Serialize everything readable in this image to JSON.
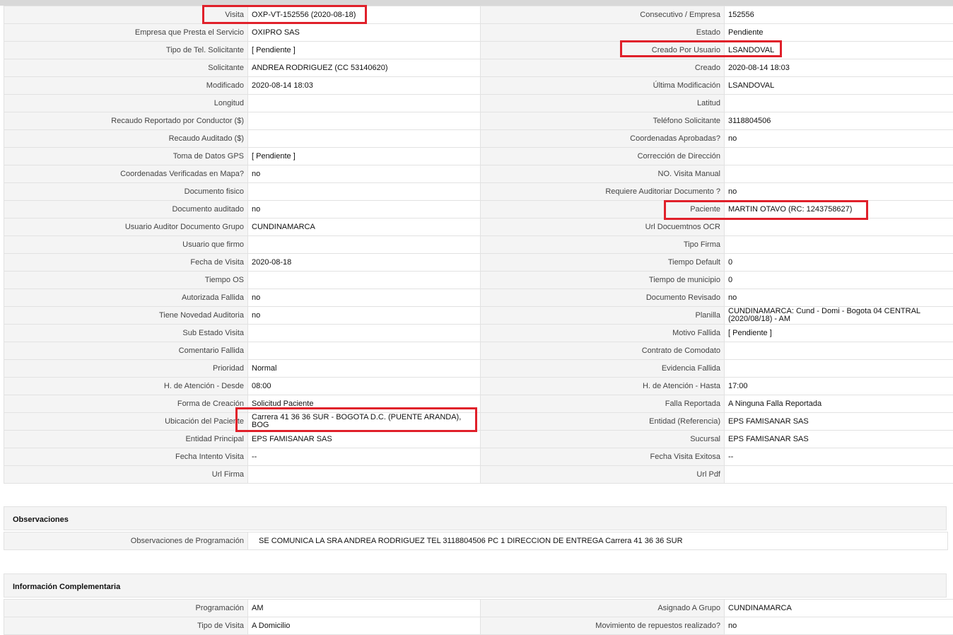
{
  "detalle": {
    "rows": [
      [
        "Visita",
        "OXP-VT-152556 (2020-08-18)",
        "Consecutivo / Empresa",
        "152556"
      ],
      [
        "Empresa que Presta el Servicio",
        "OXIPRO SAS",
        "Estado",
        "Pendiente"
      ],
      [
        "Tipo de Tel. Solicitante",
        "[ Pendiente ]",
        "Creado Por Usuario",
        "LSANDOVAL"
      ],
      [
        "Solicitante",
        "ANDREA RODRIGUEZ (CC 53140620)",
        "Creado",
        "2020-08-14 18:03"
      ],
      [
        "Modificado",
        "2020-08-14 18:03",
        "Última Modificación",
        " LSANDOVAL"
      ],
      [
        "Longitud",
        "",
        "Latitud",
        ""
      ],
      [
        "Recaudo Reportado por Conductor ($)",
        "",
        "Teléfono Solicitante",
        "3118804506"
      ],
      [
        "Recaudo Auditado ($)",
        "",
        "Coordenadas Aprobadas?",
        " no"
      ],
      [
        "Toma de Datos GPS",
        "[ Pendiente ]",
        "Corrección de Dirección",
        ""
      ],
      [
        "Coordenadas Verificadas en Mapa?",
        " no",
        "NO. Visita Manual",
        ""
      ],
      [
        "Documento fisico",
        "",
        "Requiere Auditoriar Documento ?",
        " no"
      ],
      [
        "Documento auditado",
        " no",
        "Paciente",
        "MARTIN OTAVO (RC: 1243758627)"
      ],
      [
        "Usuario Auditor Documento Grupo",
        "CUNDINAMARCA",
        "Url Docuemtnos OCR",
        ""
      ],
      [
        "Usuario que firmo",
        "",
        "Tipo Firma",
        ""
      ],
      [
        "Fecha de Visita",
        " 2020-08-18",
        "Tiempo Default",
        "0"
      ],
      [
        "Tiempo OS",
        "",
        "Tiempo de municipio",
        "0"
      ],
      [
        "Autorizada Fallida",
        " no",
        "Documento Revisado",
        " no"
      ],
      [
        "Tiene Novedad Auditoria",
        " no",
        "Planilla",
        "CUNDINAMARCA: Cund - Domi - Bogota 04 CENTRAL (2020/08/18) - AM"
      ],
      [
        "Sub Estado Visita",
        "",
        "Motivo Fallida",
        "[ Pendiente ]"
      ],
      [
        "Comentario Fallida",
        "",
        "Contrato de Comodato",
        ""
      ],
      [
        "Prioridad",
        "Normal",
        "Evidencia Fallida",
        ""
      ],
      [
        "H. de Atención - Desde",
        "08:00",
        "H. de Atención - Hasta",
        "17:00"
      ],
      [
        "Forma de Creación",
        "Solicitud Paciente",
        "Falla Reportada",
        "A Ninguna Falla Reportada"
      ],
      [
        "Ubicación del Paciente",
        "Carrera 41 36 36 SUR - BOGOTA D.C. (PUENTE ARANDA), BOG",
        "Entidad (Referencia)",
        "EPS FAMISANAR SAS"
      ],
      [
        "Entidad Principal",
        "EPS FAMISANAR SAS",
        "Sucursal",
        "EPS FAMISANAR SAS"
      ],
      [
        "Fecha Intento Visita",
        " --",
        "Fecha Visita Exitosa",
        " --"
      ],
      [
        "Url Firma",
        "",
        "Url Pdf",
        ""
      ]
    ]
  },
  "observaciones": {
    "title": "Observaciones",
    "label": "Observaciones de Programación",
    "value": "SE COMUNICA LA SRA ANDREA RODRIGUEZ TEL 3118804506 PC 1 DIRECCION DE ENTREGA Carrera 41 36 36 SUR"
  },
  "complementaria": {
    "title": "Información Complementaria",
    "rows": [
      [
        "Programación",
        "AM",
        "Asignado A Grupo",
        "CUNDINAMARCA"
      ],
      [
        "Tipo de Visita",
        "A Domicilio",
        "Movimiento de repuestos realizado?",
        " no"
      ]
    ]
  },
  "highlight_color": "#e0202a"
}
